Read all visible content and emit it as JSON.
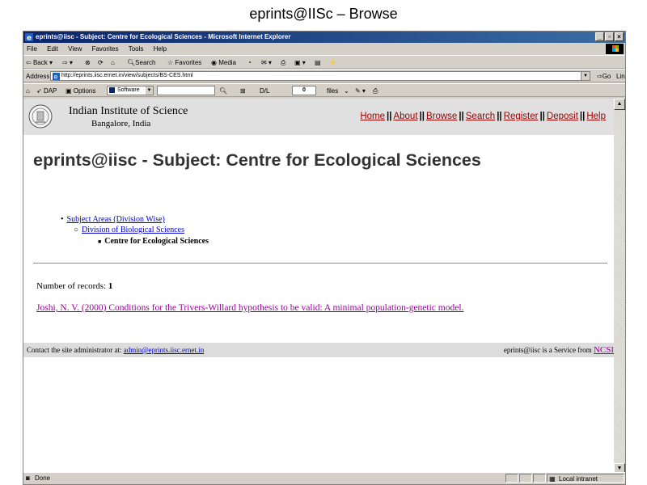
{
  "slide_title": "eprints@IISc – Browse",
  "window": {
    "title": "eprints@iisc - Subject: Centre for Ecological Sciences - Microsoft Internet Explorer"
  },
  "menu": [
    "File",
    "Edit",
    "View",
    "Favorites",
    "Tools",
    "Help"
  ],
  "toolbar": {
    "back": "Back",
    "search": "Search",
    "favorites": "Favorites",
    "media": "Media"
  },
  "address": {
    "label": "Address",
    "url": "http://eprints.iisc.ernet.in/view/subjects/BS-CES.html",
    "go": "Go",
    "links": "Links"
  },
  "toolbar2": {
    "dap": "DAP",
    "options": "Options",
    "software": "Software",
    "dl_label": "D/L",
    "dl_value": "0",
    "files": "files"
  },
  "header": {
    "institute": "Indian Institute of Science",
    "location": "Bangalore, India",
    "nav": [
      "Home",
      "About",
      "Browse",
      "Search",
      "Register",
      "Deposit",
      "Help"
    ],
    "nav_sep": "||"
  },
  "page": {
    "heading": "eprints@iisc - Subject: Centre for Ecological Sciences",
    "breadcrumb": [
      "Subject Areas (Division Wise)",
      "Division of Biological Sciences",
      "Centre for Ecological Sciences"
    ],
    "records_label": "Number of records:",
    "records_count": "1",
    "record": "Joshi, N. V. (2000) Conditions for the Trivers-Willard hypothesis to be valid: A minimal population-genetic model."
  },
  "footer": {
    "contact_text": "Contact the site administrator at:",
    "contact_email": "admin@eprints.iisc.ernet.in",
    "service_text": "eprints@iisc is a Service from",
    "service_link": "NCSI"
  },
  "status": {
    "text": "Done",
    "zone": "Local intranet"
  },
  "colors": {
    "titlebar": "#0a246a",
    "nav_link": "#990000",
    "visited_link": "#990099",
    "link": "#0000cc",
    "heading": "#333333",
    "header_band": "#e0e0e0"
  }
}
